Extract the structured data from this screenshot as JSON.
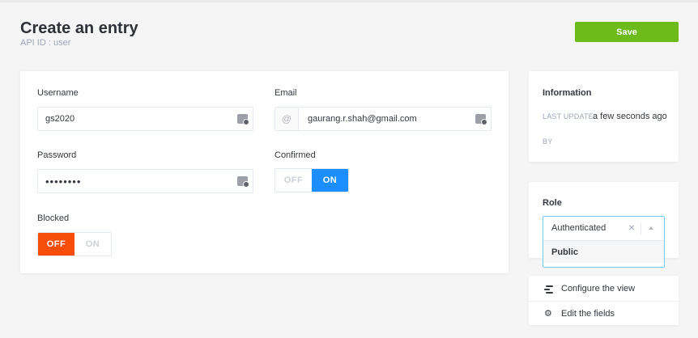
{
  "header": {
    "title": "Create an entry",
    "api_id": "API ID : user",
    "save_label": "Save"
  },
  "form": {
    "username": {
      "label": "Username",
      "value": "gs2020"
    },
    "email": {
      "label": "Email",
      "prefix": "@",
      "value": "gaurang.r.shah@gmail.com"
    },
    "password": {
      "label": "Password",
      "value": "••••••••"
    },
    "confirmed": {
      "label": "Confirmed",
      "off_label": "OFF",
      "on_label": "ON",
      "value": "on"
    },
    "blocked": {
      "label": "Blocked",
      "off_label": "OFF",
      "on_label": "ON",
      "value": "off"
    }
  },
  "information": {
    "title": "Information",
    "last_update_label": "LAST UPDATE",
    "last_update_value": "a few seconds ago",
    "by_label": "BY"
  },
  "role": {
    "title": "Role",
    "selected": "Authenticated",
    "clear": "×",
    "options": [
      "Public"
    ]
  },
  "links": {
    "configure_view": "Configure the view",
    "edit_fields": "Edit the fields"
  },
  "colors": {
    "save": "#6dbb1a",
    "toggle_on": "#1c8eff",
    "toggle_off": "#f64d0a",
    "select_focus": "#78caff"
  },
  "icons": {
    "input_keyboard": "keyboard-icon",
    "configure": "list-icon",
    "edit": "gear-icon"
  }
}
